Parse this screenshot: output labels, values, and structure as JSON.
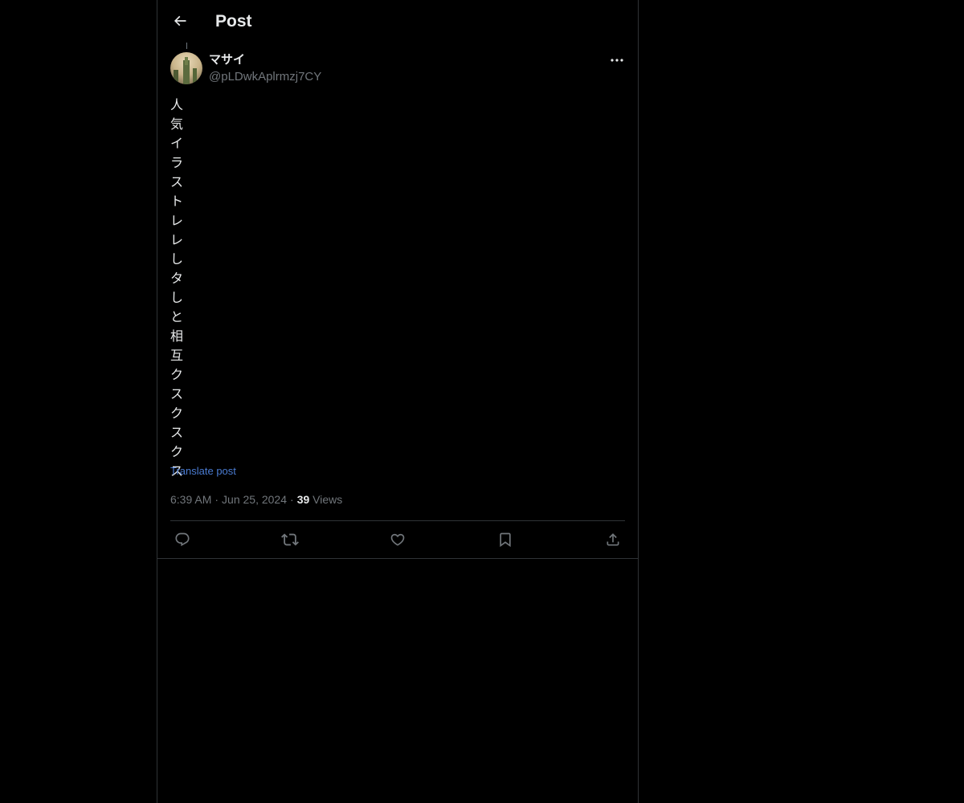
{
  "header": {
    "title": "Post"
  },
  "post": {
    "author": {
      "display_name": "マサイ",
      "handle": "@pLDwkAplrmzj7CY"
    },
    "text": "人気イラストレレしタしと相互クスクスクス",
    "translate_label": "Translate post",
    "time": "6:39 AM",
    "date": "Jun 25, 2024",
    "views_count": "39",
    "views_label": "Views",
    "separator": "·"
  },
  "actions": {
    "reply": "reply-icon",
    "repost": "repost-icon",
    "like": "heart-icon",
    "bookmark": "bookmark-icon",
    "share": "share-icon"
  },
  "colors": {
    "background": "#000000",
    "border": "#2f3336",
    "text_primary": "#e7e9ea",
    "text_secondary": "#71767b",
    "link": "#4a7bd1"
  }
}
